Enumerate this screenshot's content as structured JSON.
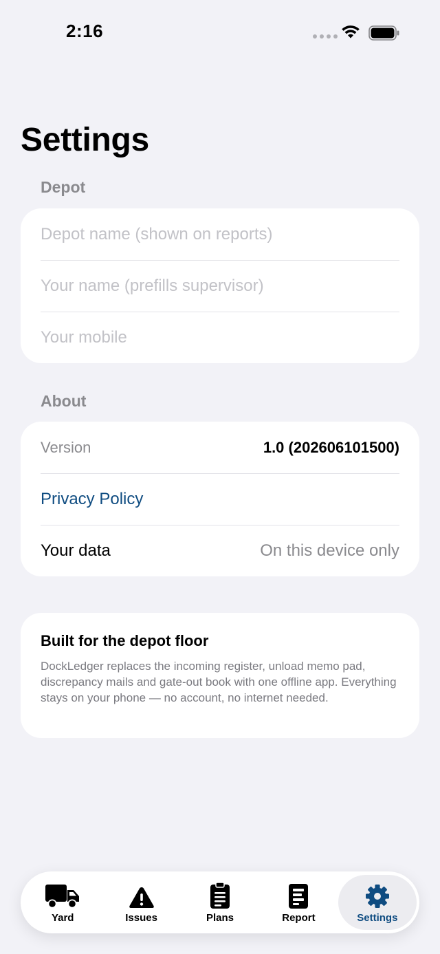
{
  "status_bar": {
    "time": "2:16"
  },
  "page_title": "Settings",
  "depot_section": {
    "header": "Depot",
    "fields": [
      {
        "placeholder": "Depot name (shown on reports)",
        "value": ""
      },
      {
        "placeholder": "Your name (prefills supervisor)",
        "value": ""
      },
      {
        "placeholder": "Your mobile",
        "value": ""
      }
    ]
  },
  "about_section": {
    "header": "About",
    "version_label": "Version",
    "version_value": "1.0 (202606101500)",
    "privacy_label": "Privacy Policy",
    "data_label": "Your data",
    "data_value": "On this device only"
  },
  "info_card": {
    "title": "Built for the depot floor",
    "body": "DockLedger replaces the incoming register, unload memo pad, discrepancy mails and gate-out book with one offline app. Everything stays on your phone — no account, no internet needed."
  },
  "tabs": [
    {
      "label": "Yard",
      "icon": "truck-icon"
    },
    {
      "label": "Issues",
      "icon": "warning-icon"
    },
    {
      "label": "Plans",
      "icon": "clipboard-icon"
    },
    {
      "label": "Report",
      "icon": "report-icon"
    },
    {
      "label": "Settings",
      "icon": "gear-icon",
      "active": true
    }
  ],
  "colors": {
    "background": "#F2F2F7",
    "accent": "#0F4C81",
    "secondary_text": "#8A8A8E",
    "placeholder": "#C2C2C7"
  }
}
